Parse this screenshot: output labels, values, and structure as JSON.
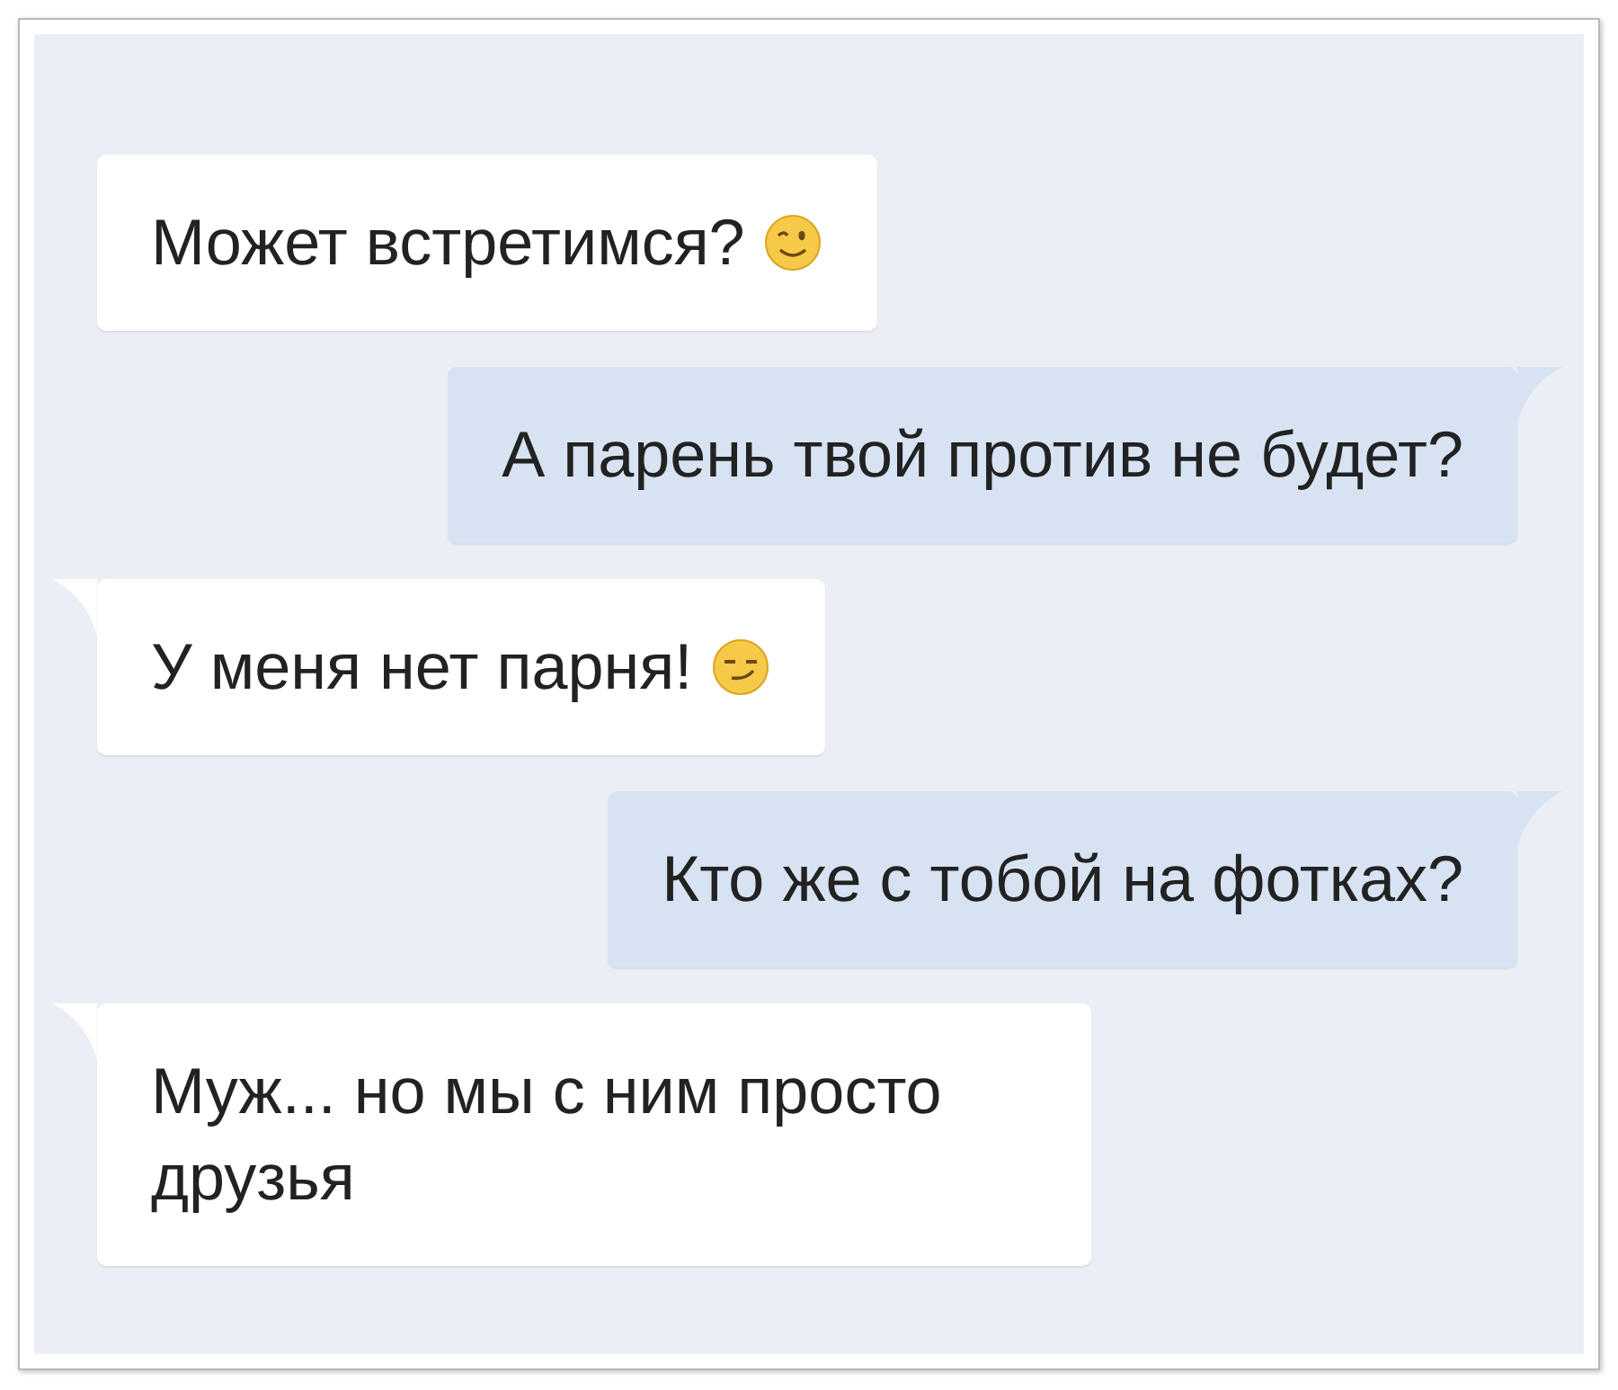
{
  "messages": [
    {
      "kind": "incoming",
      "tail": false,
      "text": "Может встретимся?",
      "emoji": {
        "kind": "wink"
      }
    },
    {
      "kind": "outgoing",
      "tail": true,
      "text": "А парень твой против не будет?"
    },
    {
      "kind": "incoming",
      "tail": true,
      "text": "У меня нет парня!",
      "emoji": {
        "kind": "smirk"
      }
    },
    {
      "kind": "outgoing",
      "tail": true,
      "text": "Кто же с тобой на фотках?"
    },
    {
      "kind": "incoming",
      "tail": true,
      "text": "Муж... но мы с ним просто друзья"
    }
  ]
}
